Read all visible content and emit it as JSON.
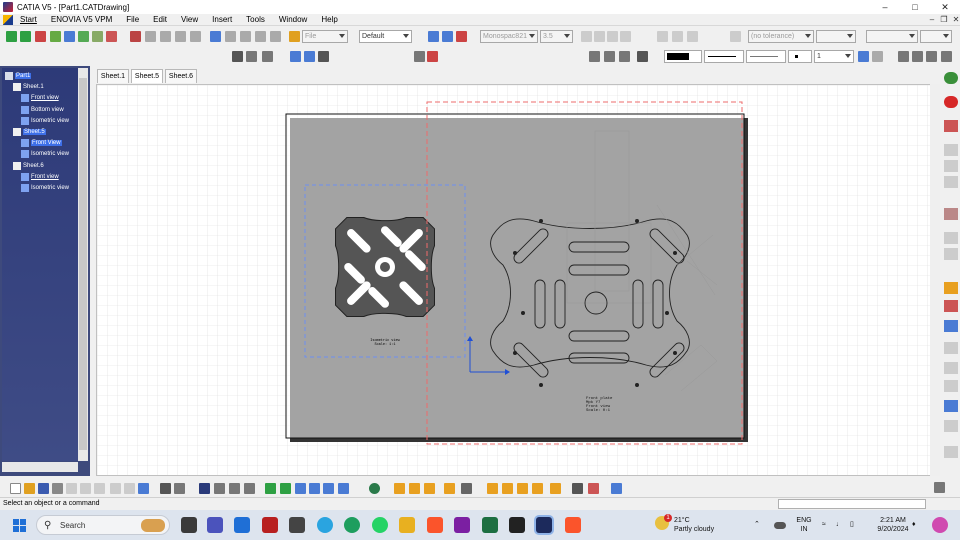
{
  "window": {
    "title": "CATIA V5 - [Part1.CATDrawing]",
    "minimize": "–",
    "maximize": "□",
    "close": "✕",
    "restore": "❐"
  },
  "menu": [
    "Start",
    "ENOVIA V5 VPM",
    "File",
    "Edit",
    "View",
    "Insert",
    "Tools",
    "Window",
    "Help"
  ],
  "toolbar": {
    "file_combo": "File",
    "style_combo": "Default",
    "font_combo": "Monospac821",
    "font_size": "3.5",
    "tolerance_combo": "(no tolerance)",
    "line_weight": "1"
  },
  "tree": {
    "nodes": [
      {
        "label": "Part1",
        "style": "sel",
        "icon": "drawing-icon",
        "depth": 0
      },
      {
        "label": "Sheet.1",
        "style": "plain",
        "icon": "sheet-icon",
        "depth": 1
      },
      {
        "label": "Front view",
        "style": "link",
        "icon": "view-icon",
        "depth": 2
      },
      {
        "label": "Bottom view",
        "style": "plain",
        "icon": "view-icon",
        "depth": 2
      },
      {
        "label": "Isometric view",
        "style": "plain",
        "icon": "view-icon",
        "depth": 2
      },
      {
        "label": "Sheet.5",
        "style": "sel",
        "icon": "sheet-icon",
        "depth": 1
      },
      {
        "label": "Front View",
        "style": "sel",
        "icon": "view-icon",
        "depth": 2
      },
      {
        "label": "Isometric view",
        "style": "plain",
        "icon": "view-icon",
        "depth": 2
      },
      {
        "label": "Sheet.6",
        "style": "plain",
        "icon": "sheet-icon",
        "depth": 1
      },
      {
        "label": "Front view",
        "style": "link",
        "icon": "view-icon",
        "depth": 2
      },
      {
        "label": "Isometric view",
        "style": "plain",
        "icon": "view-icon",
        "depth": 2
      }
    ]
  },
  "tabs": [
    "Sheet.1",
    "Sheet.5",
    "Sheet.6"
  ],
  "drawing": {
    "left_view_caption": [
      "Isometric view",
      "Scale: 1:1"
    ],
    "right_view_caption": [
      "Front plate",
      "Mpk Y7",
      "Front view",
      "Scale:  0:1"
    ]
  },
  "status": {
    "message": "Select an object or a command"
  },
  "taskbar": {
    "search_placeholder": "Search",
    "weather_temp": "21°C",
    "weather_desc": "Partly cloudy",
    "lang": "ENG",
    "lang_region": "IN",
    "time": "2:21 AM",
    "date": "9/20/2024",
    "weather_badge": "1"
  },
  "colors": {
    "tree_bg": "#2d3a78",
    "accent": "#1f6fd6",
    "view_frame_blue": "#6d8ff0",
    "view_frame_red": "#ee6b6b"
  }
}
